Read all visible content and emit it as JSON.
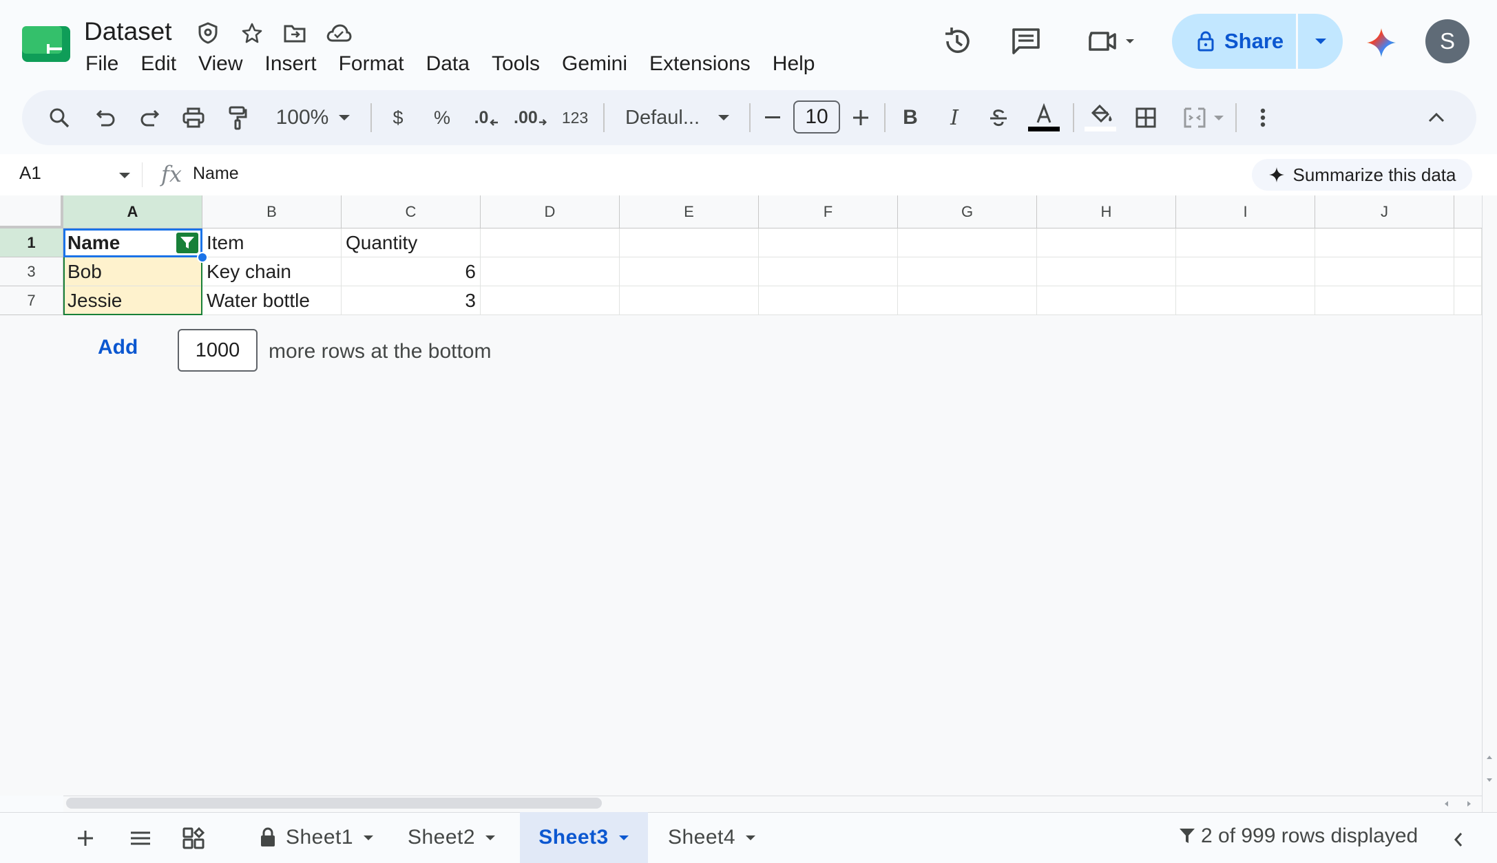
{
  "doc": {
    "title": "Dataset"
  },
  "menu": [
    "File",
    "Edit",
    "View",
    "Insert",
    "Format",
    "Data",
    "Tools",
    "Gemini",
    "Extensions",
    "Help"
  ],
  "share": {
    "label": "Share",
    "color": "#c2e7ff"
  },
  "avatar": {
    "initial": "S",
    "color": "#5f6b77"
  },
  "toolbar": {
    "zoom": "100%",
    "currency": "$",
    "percent": "%",
    "dec_decrease": ".0",
    "dec_increase": ".00",
    "number_format": "123",
    "font": "Defaul...",
    "font_size": "10",
    "bold": "B",
    "italic": "I"
  },
  "formula_bar": {
    "cell_ref": "A1",
    "fx": "fx",
    "value": "Name",
    "summarize_label": "Summarize this data"
  },
  "columns": [
    "A",
    "B",
    "C",
    "D",
    "E",
    "F",
    "G",
    "H",
    "I",
    "J"
  ],
  "rows": [
    {
      "num": "1",
      "cells": [
        "Name",
        "Item",
        "Quantity"
      ]
    },
    {
      "num": "3",
      "cells": [
        "Bob",
        "Key chain",
        "6"
      ]
    },
    {
      "num": "7",
      "cells": [
        "Jessie",
        "Water bottle",
        "3"
      ]
    }
  ],
  "add_rows": {
    "button": "Add",
    "count": "1000",
    "suffix": "more rows at the bottom"
  },
  "sheets": [
    {
      "name": "Sheet1",
      "locked": true,
      "active": false
    },
    {
      "name": "Sheet2",
      "locked": false,
      "active": false
    },
    {
      "name": "Sheet3",
      "locked": false,
      "active": true
    },
    {
      "name": "Sheet4",
      "locked": false,
      "active": false
    }
  ],
  "status": {
    "rows_displayed": "2 of 999 rows displayed"
  },
  "colors": {
    "accent": "#0b57d0",
    "selected_header": "#d3e9d9",
    "filter_green": "#188038",
    "filtered_fill": "#fef2cd",
    "selection": "#1a73e8"
  }
}
